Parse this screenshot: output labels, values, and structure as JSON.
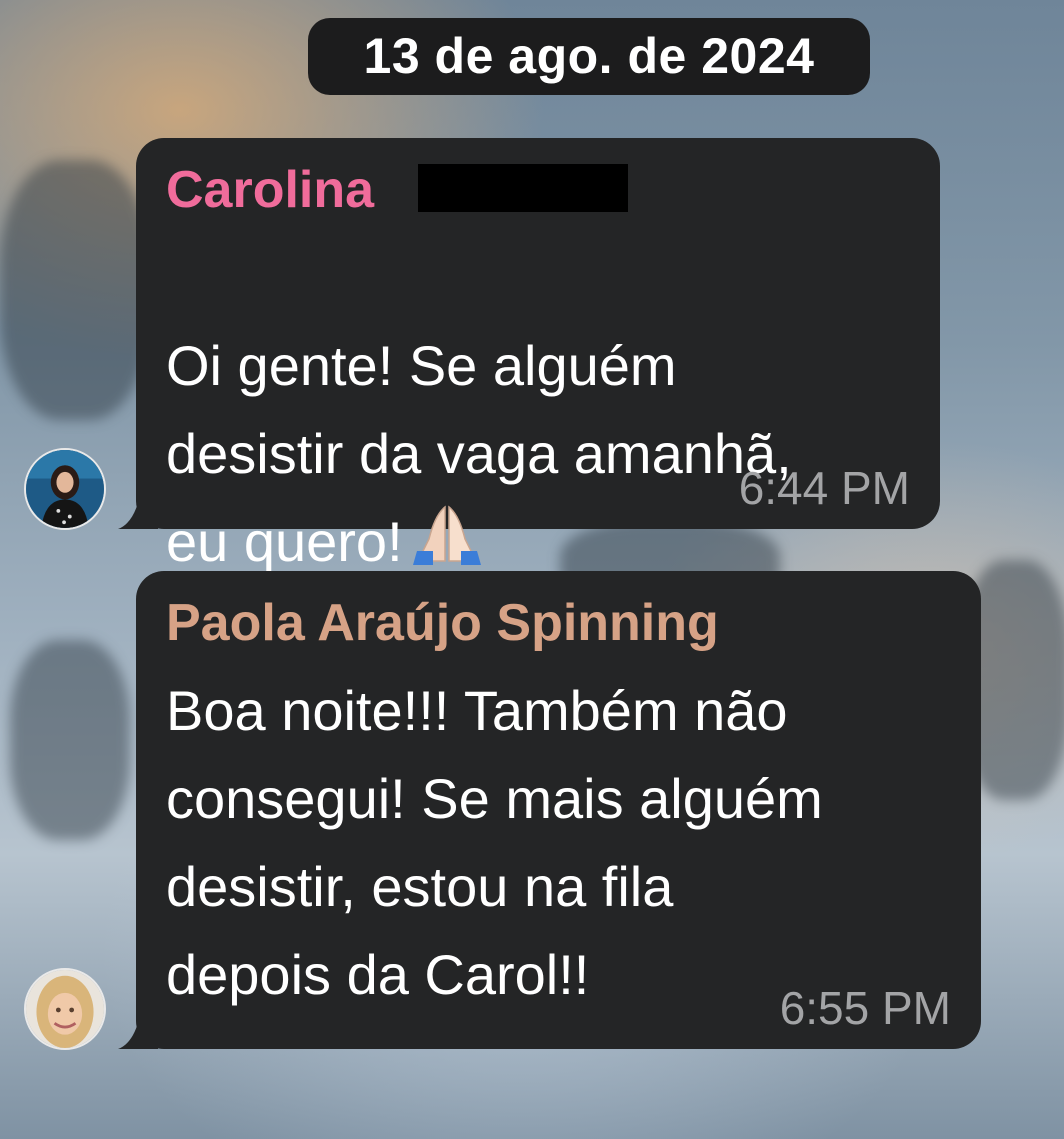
{
  "date_separator": "13 de ago. de 2024",
  "messages": [
    {
      "sender": "Carolina",
      "sender_color": "#f06c9b",
      "text": "Oi gente! Se alguém\ndesistir da vaga amanhã,\neu quero!",
      "emoji": "folded-hands",
      "time": "6:44 PM"
    },
    {
      "sender": "Paola Araújo Spinning",
      "sender_color": "#d6a286",
      "text": "Boa noite!!! Também não\nconsegui! Se mais alguém\ndesistir, estou na fila\ndepois da Carol!!",
      "time": "6:55 PM"
    }
  ],
  "colors": {
    "bubble_bg": "#242526",
    "timestamp": "#a3a4a6",
    "date_chip_bg": "#1c1c1d"
  }
}
